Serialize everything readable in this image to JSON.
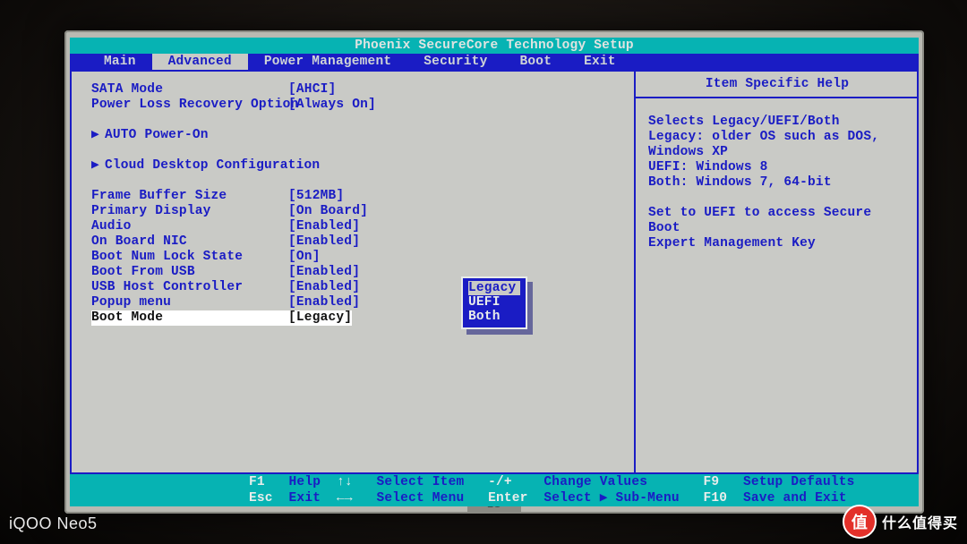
{
  "title": "Phoenix SecureCore Technology Setup",
  "menu": {
    "items": [
      "Main",
      "Advanced",
      "Power Management",
      "Security",
      "Boot",
      "Exit"
    ],
    "active_index": 1
  },
  "settings": [
    {
      "type": "kv",
      "label": "SATA Mode",
      "value": "[AHCI]"
    },
    {
      "type": "kv",
      "label": "Power Loss Recovery Option",
      "value": "[Always On]"
    },
    {
      "type": "spacer"
    },
    {
      "type": "submenu",
      "label": "AUTO Power-On"
    },
    {
      "type": "spacer"
    },
    {
      "type": "submenu",
      "label": "Cloud Desktop Configuration"
    },
    {
      "type": "spacer"
    },
    {
      "type": "kv",
      "label": "Frame Buffer Size",
      "value": "[512MB]"
    },
    {
      "type": "kv",
      "label": "Primary Display",
      "value": "[On Board]"
    },
    {
      "type": "kv",
      "label": "Audio",
      "value": "[Enabled]"
    },
    {
      "type": "kv",
      "label": "On Board NIC",
      "value": "[Enabled]"
    },
    {
      "type": "kv",
      "label": "Boot Num Lock State",
      "value": "[On]"
    },
    {
      "type": "kv",
      "label": "Boot From USB",
      "value": "[Enabled]"
    },
    {
      "type": "kv",
      "label": "USB Host Controller",
      "value": "[Enabled]"
    },
    {
      "type": "kv",
      "label": "Popup menu",
      "value": "[Enabled]"
    },
    {
      "type": "kv",
      "label": "Boot Mode",
      "value": "[Legacy]",
      "selected": true
    }
  ],
  "popup": {
    "options": [
      "Legacy",
      "UEFI",
      "Both"
    ],
    "selected_index": 0
  },
  "help": {
    "title": "Item Specific Help",
    "body": "Selects Legacy/UEFI/Both\nLegacy: older OS such as DOS,\nWindows XP\nUEFI: Windows 8\nBoth: Windows 7, 64-bit\n\nSet to UEFI to access Secure Boot\nExpert Management Key"
  },
  "footer": {
    "keys": {
      "f1": "F1",
      "help": "Help",
      "arrows_v": "↑↓",
      "select_item": "Select Item",
      "plusminus": "-/+",
      "change_values": "Change Values",
      "f9": "F9",
      "setup_defaults": "Setup Defaults",
      "esc": "Esc",
      "exit": "Exit",
      "arrows_h": "←→",
      "select_menu": "Select Menu",
      "enter": "Enter",
      "select_sub": "Select ▶ Sub-Menu",
      "f10": "F10",
      "save_exit": "Save and Exit"
    }
  },
  "watermark": {
    "phone": "iQOO Neo5",
    "site": "什么值得买",
    "badge": "值",
    "monitor_brand": "LG"
  }
}
